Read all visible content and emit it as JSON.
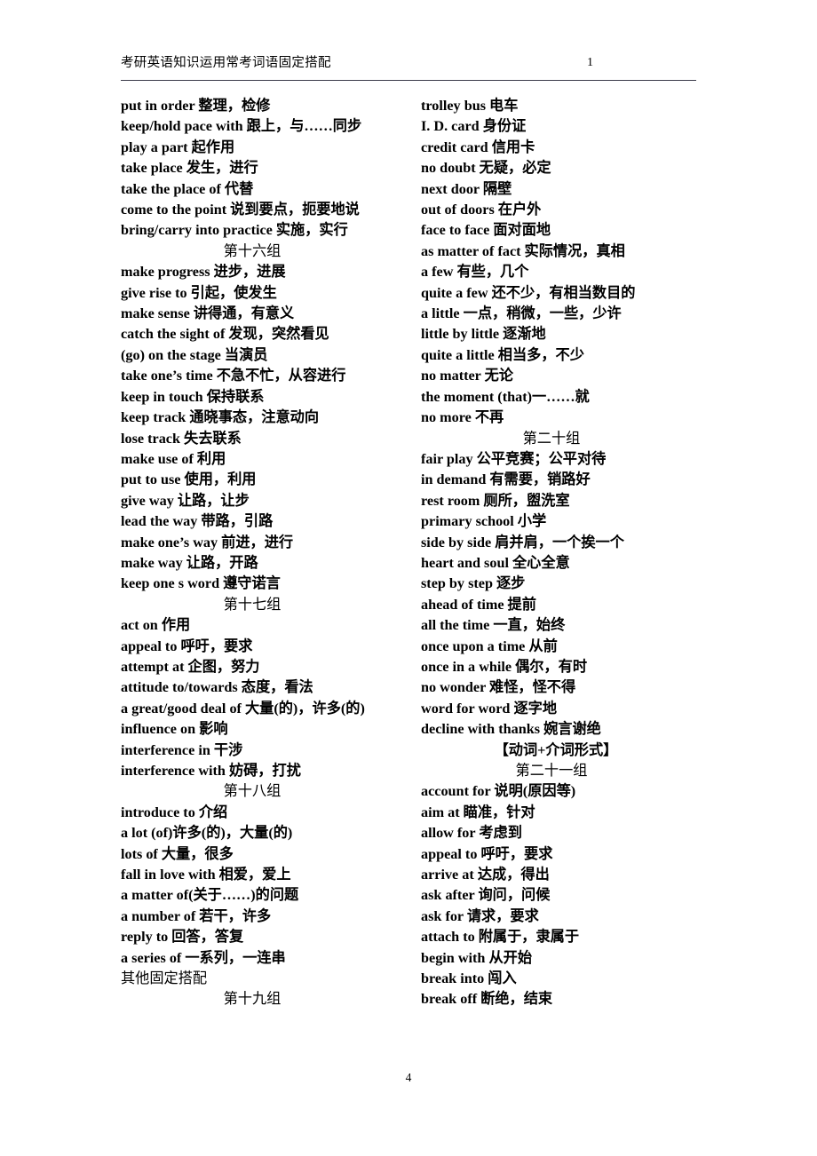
{
  "header": {
    "title": "考研英语知识运用常考词语固定搭配",
    "page_ref": "1"
  },
  "footer": {
    "page_number": "4"
  },
  "columns": {
    "left": [
      {
        "type": "entry",
        "text": "put in order 整理，检修"
      },
      {
        "type": "entry",
        "text": "keep/hold pace with 跟上，与……同步"
      },
      {
        "type": "entry",
        "text": "play a part 起作用"
      },
      {
        "type": "entry",
        "text": "take place 发生，进行"
      },
      {
        "type": "entry",
        "text": "take the place of 代替"
      },
      {
        "type": "entry",
        "text": "come to the point 说到要点，扼要地说"
      },
      {
        "type": "entry",
        "text": "bring/carry into practice 实施，实行"
      },
      {
        "type": "group",
        "text": "第十六组"
      },
      {
        "type": "entry",
        "text": "make progress 进步，进展"
      },
      {
        "type": "entry",
        "text": "give rise to 引起，使发生"
      },
      {
        "type": "entry",
        "text": "make sense 讲得通，有意义"
      },
      {
        "type": "entry",
        "text": "catch the sight of 发现，突然看见"
      },
      {
        "type": "entry",
        "text": "(go) on the stage 当演员"
      },
      {
        "type": "entry",
        "text": "take one’s time 不急不忙，从容进行"
      },
      {
        "type": "entry",
        "text": "keep in touch 保持联系"
      },
      {
        "type": "entry",
        "text": "keep track 通晓事态，注意动向"
      },
      {
        "type": "entry",
        "text": "lose track 失去联系"
      },
      {
        "type": "entry",
        "text": "make use of 利用"
      },
      {
        "type": "entry",
        "text": "put to use 使用，利用"
      },
      {
        "type": "entry",
        "text": "give way 让路，让步"
      },
      {
        "type": "entry",
        "text": "lead the way 带路，引路"
      },
      {
        "type": "entry",
        "text": "make one’s way 前进，进行"
      },
      {
        "type": "entry",
        "text": "make way 让路，开路"
      },
      {
        "type": "entry",
        "text": "keep one    s word 遵守诺言"
      },
      {
        "type": "group",
        "text": "第十七组"
      },
      {
        "type": "entry",
        "text": "act on 作用"
      },
      {
        "type": "entry",
        "text": "appeal to 呼吁，要求"
      },
      {
        "type": "entry",
        "text": "attempt at 企图，努力"
      },
      {
        "type": "entry",
        "text": "attitude to/towards 态度，看法"
      },
      {
        "type": "entry",
        "text": "a great/good deal of 大量(的)，许多(的)"
      },
      {
        "type": "entry",
        "text": "influence on 影响"
      },
      {
        "type": "entry",
        "text": "interference in 干涉"
      },
      {
        "type": "entry",
        "text": "interference with 妨碍，打扰"
      },
      {
        "type": "group",
        "text": "第十八组"
      },
      {
        "type": "entry",
        "text": "introduce to 介绍"
      },
      {
        "type": "entry",
        "text": "a lot (of)许多(的)，大量(的)"
      },
      {
        "type": "entry",
        "text": "lots of 大量，很多"
      },
      {
        "type": "entry",
        "text": "fall in love with 相爱，爱上"
      },
      {
        "type": "entry",
        "text": "a matter of(关于……)的问题"
      },
      {
        "type": "entry",
        "text": "a number of 若干，许多"
      },
      {
        "type": "entry",
        "text": "reply to 回答，答复"
      },
      {
        "type": "entry",
        "text": "a series of 一系列，一连串"
      },
      {
        "type": "plain",
        "text": "其他固定搭配"
      },
      {
        "type": "group",
        "text": "第十九组"
      }
    ],
    "right": [
      {
        "type": "entry",
        "text": "trolley bus 电车"
      },
      {
        "type": "entry",
        "text": "I. D. card 身份证"
      },
      {
        "type": "entry",
        "text": "credit card 信用卡"
      },
      {
        "type": "entry",
        "text": "no doubt 无疑，必定"
      },
      {
        "type": "entry",
        "text": "next door 隔壁"
      },
      {
        "type": "entry",
        "text": "out of doors 在户外"
      },
      {
        "type": "entry",
        "text": "face to face 面对面地"
      },
      {
        "type": "entry",
        "text": "as matter of fact 实际情况，真相"
      },
      {
        "type": "entry",
        "text": "a few 有些，几个"
      },
      {
        "type": "entry",
        "text": "quite a few 还不少，有相当数目的"
      },
      {
        "type": "entry",
        "text": "a little 一点，稍微，一些，少许"
      },
      {
        "type": "entry",
        "text": "little by little 逐渐地"
      },
      {
        "type": "entry",
        "text": "quite a little 相当多，不少"
      },
      {
        "type": "entry",
        "text": "no matter 无论"
      },
      {
        "type": "entry",
        "text": "the moment (that)一……就"
      },
      {
        "type": "entry",
        "text": "no more 不再"
      },
      {
        "type": "group",
        "text": "第二十组"
      },
      {
        "type": "entry",
        "text": "fair play 公平竞赛；公平对待"
      },
      {
        "type": "entry",
        "text": "in demand 有需要，销路好"
      },
      {
        "type": "entry",
        "text": "rest room 厕所，盥洗室"
      },
      {
        "type": "entry",
        "text": "primary school 小学"
      },
      {
        "type": "entry",
        "text": "side by side 肩并肩，一个挨一个"
      },
      {
        "type": "entry",
        "text": "heart and soul 全心全意"
      },
      {
        "type": "entry",
        "text": "step by step 逐步"
      },
      {
        "type": "entry",
        "text": "ahead of time 提前"
      },
      {
        "type": "entry",
        "text": "all the time 一直，始终"
      },
      {
        "type": "entry",
        "text": "once upon a time 从前"
      },
      {
        "type": "entry",
        "text": "once in a while 偶尔，有时"
      },
      {
        "type": "entry",
        "text": "no wonder 难怪，怪不得"
      },
      {
        "type": "entry",
        "text": "word for word 逐字地"
      },
      {
        "type": "entry",
        "text": "decline with thanks 婉言谢绝"
      },
      {
        "type": "group-bold",
        "text": "【动词+介词形式】"
      },
      {
        "type": "group",
        "text": "第二十一组"
      },
      {
        "type": "entry",
        "text": "account for 说明(原因等)"
      },
      {
        "type": "entry",
        "text": "aim at 瞄准，针对"
      },
      {
        "type": "entry",
        "text": "allow for 考虑到"
      },
      {
        "type": "entry",
        "text": "appeal to 呼吁，要求"
      },
      {
        "type": "entry",
        "text": "arrive at 达成，得出"
      },
      {
        "type": "entry",
        "text": "ask after 询问，问候"
      },
      {
        "type": "entry",
        "text": "ask for 请求，要求"
      },
      {
        "type": "entry",
        "text": "attach to 附属于，隶属于"
      },
      {
        "type": "entry",
        "text": "begin with 从开始"
      },
      {
        "type": "entry",
        "text": "break into 闯入"
      },
      {
        "type": "entry",
        "text": "break off 断绝，结束"
      }
    ]
  }
}
